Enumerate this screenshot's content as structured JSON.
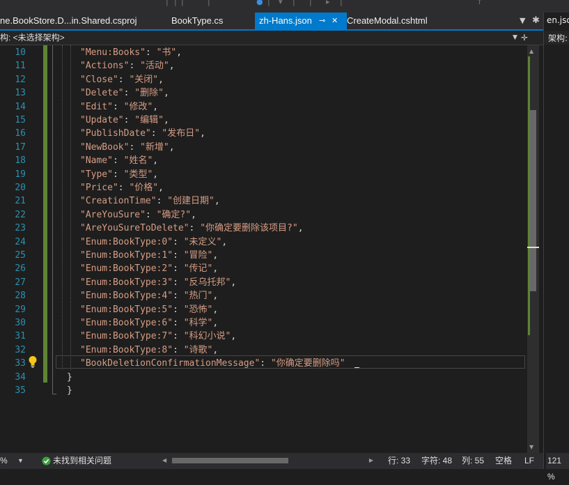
{
  "tabs": [
    {
      "label": "ne.BookStore.D...in.Shared.csproj",
      "active": false
    },
    {
      "label": "BookType.cs",
      "active": false
    },
    {
      "label": "zh-Hans.json",
      "active": true
    },
    {
      "label": "CreateModal.cshtml",
      "active": false
    }
  ],
  "right_panel": {
    "tab_label": "en.jso",
    "nav_label": "架构:"
  },
  "nav": {
    "schema_label": "构: <未选择架构>"
  },
  "editor": {
    "lines": [
      {
        "n": "10",
        "key": "\"Menu:Books\"",
        "value": "\"书\"",
        "tail": ","
      },
      {
        "n": "11",
        "key": "\"Actions\"",
        "value": "\"活动\"",
        "tail": ","
      },
      {
        "n": "12",
        "key": "\"Close\"",
        "value": "\"关闭\"",
        "tail": ","
      },
      {
        "n": "13",
        "key": "\"Delete\"",
        "value": "\"删除\"",
        "tail": ","
      },
      {
        "n": "14",
        "key": "\"Edit\"",
        "value": "\"修改\"",
        "tail": ","
      },
      {
        "n": "15",
        "key": "\"Update\"",
        "value": "\"编辑\"",
        "tail": ","
      },
      {
        "n": "16",
        "key": "\"PublishDate\"",
        "value": "\"发布日\"",
        "tail": ","
      },
      {
        "n": "17",
        "key": "\"NewBook\"",
        "value": "\"新增\"",
        "tail": ","
      },
      {
        "n": "18",
        "key": "\"Name\"",
        "value": "\"姓名\"",
        "tail": ","
      },
      {
        "n": "19",
        "key": "\"Type\"",
        "value": "\"类型\"",
        "tail": ","
      },
      {
        "n": "20",
        "key": "\"Price\"",
        "value": "\"价格\"",
        "tail": ","
      },
      {
        "n": "21",
        "key": "\"CreationTime\"",
        "value": "\"创建日期\"",
        "tail": ","
      },
      {
        "n": "22",
        "key": "\"AreYouSure\"",
        "value": "\"确定?\"",
        "tail": ","
      },
      {
        "n": "23",
        "key": "\"AreYouSureToDelete\"",
        "value": "\"你确定要删除该项目?\"",
        "tail": ","
      },
      {
        "n": "24",
        "key": "\"Enum:BookType:0\"",
        "value": "\"未定义\"",
        "tail": ","
      },
      {
        "n": "25",
        "key": "\"Enum:BookType:1\"",
        "value": "\"冒险\"",
        "tail": ","
      },
      {
        "n": "26",
        "key": "\"Enum:BookType:2\"",
        "value": "\"传记\"",
        "tail": ","
      },
      {
        "n": "27",
        "key": "\"Enum:BookType:3\"",
        "value": "\"反乌托邦\"",
        "tail": ","
      },
      {
        "n": "28",
        "key": "\"Enum:BookType:4\"",
        "value": "\"热门\"",
        "tail": ","
      },
      {
        "n": "29",
        "key": "\"Enum:BookType:5\"",
        "value": "\"恐怖\"",
        "tail": ","
      },
      {
        "n": "30",
        "key": "\"Enum:BookType:6\"",
        "value": "\"科学\"",
        "tail": ","
      },
      {
        "n": "31",
        "key": "\"Enum:BookType:7\"",
        "value": "\"科幻小说\"",
        "tail": ","
      },
      {
        "n": "32",
        "key": "\"Enum:BookType:8\"",
        "value": "\"诗歌\"",
        "tail": ","
      },
      {
        "n": "33",
        "key": "\"BookDeletionConfirmationMessage\"",
        "value": "\"你确定要删除吗\"",
        "tail": ""
      }
    ],
    "closing_lines": [
      {
        "n": "34",
        "text": "}"
      },
      {
        "n": "35",
        "text": "}"
      }
    ],
    "lightbulb_icon": "lightbulb-icon"
  },
  "status": {
    "zoom": "%",
    "issues": "未找到相关问题",
    "row": "行: 33",
    "char": "字符: 48",
    "col": "列: 55",
    "space": "空格",
    "eol": "LF",
    "right_zoom": "121 %"
  },
  "colors": {
    "accent": "#007acc",
    "string": "#d69d85",
    "line_number": "#2b91af",
    "change_bar": "#5e8434"
  }
}
